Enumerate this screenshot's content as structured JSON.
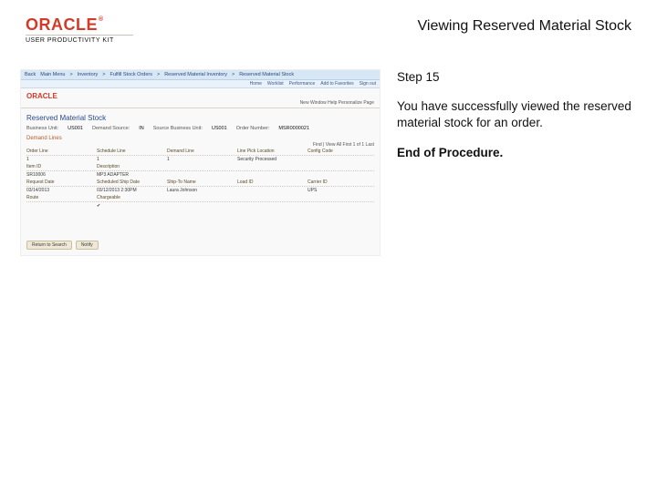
{
  "header": {
    "brand": "ORACLE",
    "reg": "®",
    "upk": "USER PRODUCTIVITY KIT",
    "title": "Viewing Reserved Material Stock"
  },
  "step": {
    "label": "Step 15",
    "body": "You have successfully viewed the reserved material stock for an order.",
    "end": "End of Procedure."
  },
  "shot": {
    "tabs": {
      "t1": "Back",
      "t2": "Main Menu",
      "t3": "Inventory",
      "t4": "Fulfill Stock Orders",
      "t5": "Reserved Material Inventory",
      "t6": "Reserved Material Stock"
    },
    "nav": {
      "n1": "Home",
      "n2": "Worklist",
      "n3": "Performance",
      "n4": "Add to Favorites",
      "n5": "Sign out"
    },
    "brand": "ORACLE",
    "toolbar": "New Window  Help  Personalize Page",
    "page_h1": "Reserved Material Stock",
    "info": {
      "bu_lbl": "Business Unit:",
      "bu_val": "US001",
      "src_lbl": "Demand Source:",
      "src_val": "IN",
      "sbu_lbl": "Source Business Unit:",
      "sbu_val": "US001",
      "ord_lbl": "Order Number:",
      "ord_val": "MSR0000021"
    },
    "section": "Demand Lines",
    "grid_filter": "Find | View All   First 1 of 1 Last",
    "grid": {
      "h1": "Order Line",
      "h2": "Schedule Line",
      "h3": "Demand Line",
      "h4": "Line Pick Location",
      "h5": "Config Code",
      "r1c1": "1",
      "r1c2": "1",
      "r1c3": "1",
      "r1c4": "Security Processed",
      "r1c5": "",
      "h6": "Item ID",
      "h7": "Description",
      "r2c1": "SR10006",
      "r2c2": "MP3 ADAPTER",
      "h8": "Request Date",
      "h9": "Scheduled Ship Date",
      "r3c1": "03/14/2013",
      "r3c2": "03/12/2013 2:30PM",
      "h10": "Ship-To Name",
      "h11": "Load ID",
      "h12": "Carrier ID",
      "r4c1": "Laura Johnson",
      "r4c2": "",
      "r4c3": "UPS",
      "h13": "Route",
      "h14": "Chargeable",
      "r5c1": "",
      "r5c2": "✔"
    },
    "buttons": {
      "b1": "Return to Search",
      "b2": "Notify"
    }
  }
}
